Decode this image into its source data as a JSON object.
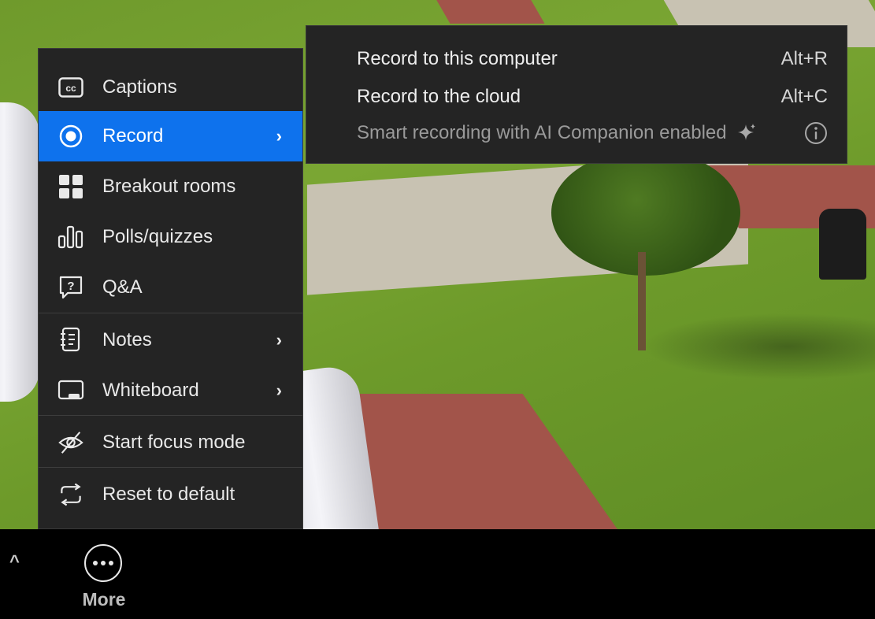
{
  "menu": {
    "items": [
      {
        "label": "Captions",
        "icon": "captions-icon",
        "has_submenu": false
      },
      {
        "label": "Record",
        "icon": "record-icon",
        "has_submenu": true,
        "active": true
      },
      {
        "label": "Breakout rooms",
        "icon": "breakout-rooms-icon",
        "has_submenu": false
      },
      {
        "label": "Polls/quizzes",
        "icon": "polls-icon",
        "has_submenu": false
      },
      {
        "label": "Q&A",
        "icon": "qa-icon",
        "has_submenu": false
      },
      {
        "label": "Notes",
        "icon": "notes-icon",
        "has_submenu": true
      },
      {
        "label": "Whiteboard",
        "icon": "whiteboard-icon",
        "has_submenu": true
      },
      {
        "label": "Start focus mode",
        "icon": "focus-mode-icon",
        "has_submenu": false
      },
      {
        "label": "Reset to default",
        "icon": "reset-icon",
        "has_submenu": false
      }
    ],
    "chevron": "›",
    "active_color": "#0e72ed"
  },
  "record_submenu": {
    "items": [
      {
        "label": "Record to this computer",
        "shortcut": "Alt+R"
      },
      {
        "label": "Record to the cloud",
        "shortcut": "Alt+C"
      },
      {
        "label": "Smart recording with AI Companion enabled",
        "icon": "sparkle-icon",
        "info_icon": "info-icon",
        "disabled": true
      }
    ]
  },
  "toolbar": {
    "caret": "^",
    "more_label": "More",
    "more_icon": "ellipsis-icon"
  }
}
